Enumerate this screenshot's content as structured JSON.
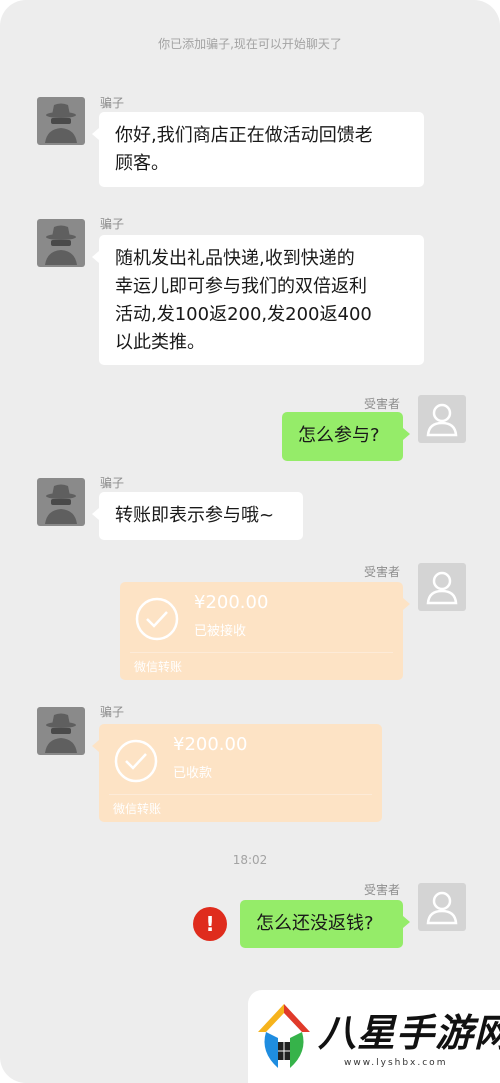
{
  "system_notice": "你已添加骗子,现在可以开始聊天了",
  "messages": {
    "m1": {
      "sender": "骗子",
      "text_line1": "你好,我们商店正在做活动回馈老",
      "text_line2": "顾客。"
    },
    "m2": {
      "sender": "骗子",
      "text_line1": "随机发出礼品快递,收到快递的",
      "text_line2": "幸运儿即可参与我们的双倍返利",
      "text_line3": "活动,发100返200,发200返400",
      "text_line4": "以此类推。"
    },
    "m3": {
      "sender": "受害者",
      "text": "怎么参与?"
    },
    "m4": {
      "sender": "骗子",
      "text": "转账即表示参与哦~"
    },
    "m5": {
      "sender": "受害者",
      "amount": "¥200.00",
      "status": "已被接收",
      "brand": "微信转账"
    },
    "m6": {
      "sender": "骗子",
      "amount": "¥200.00",
      "status": "已收款",
      "brand": "微信转账"
    },
    "time": "18:02",
    "m7": {
      "sender": "受害者",
      "text": "怎么还没返钱?",
      "alert_icon": "!"
    }
  },
  "watermark": {
    "name": "八星手游网",
    "url": "www.lyshbx.com"
  },
  "colors": {
    "background": "#ededed",
    "green_bubble": "#95ec69",
    "white_bubble": "#ffffff",
    "transfer_card": "#fde3c5",
    "alert": "#df2c1d",
    "scammer_avatar": "#8a8a8a",
    "victim_avatar": "#d4d4d4"
  },
  "icons": {
    "scammer_avatar": "spy-icon",
    "victim_avatar": "person-icon",
    "transfer_status": "checkmark-circle-icon",
    "send_failed": "exclamation-icon"
  }
}
